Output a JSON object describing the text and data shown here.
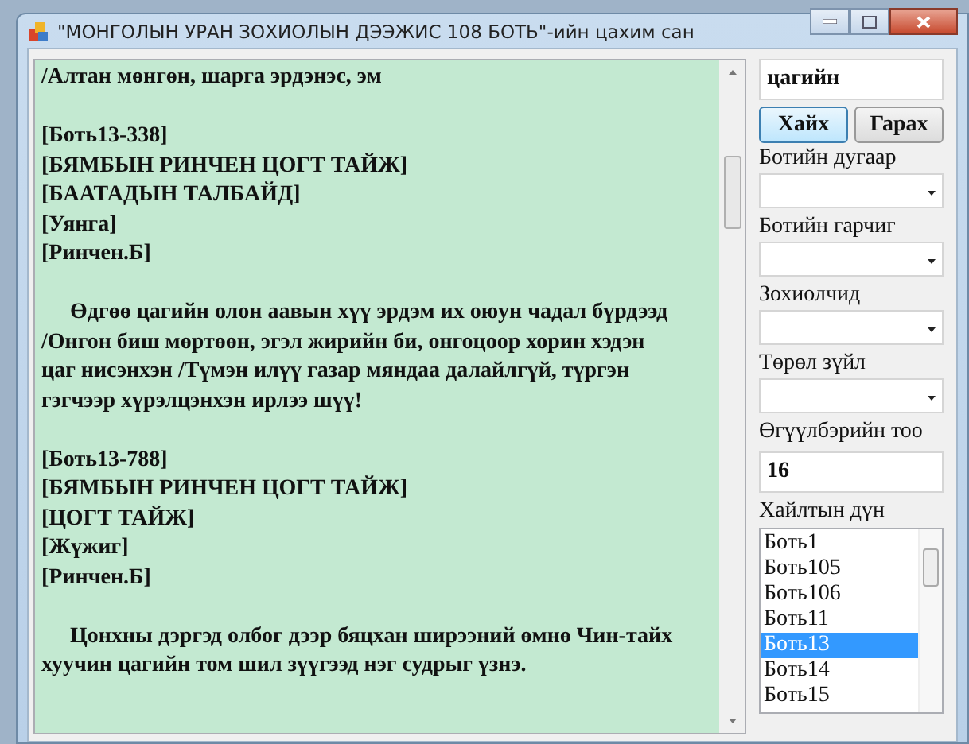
{
  "window": {
    "title": "\"МОНГОЛЫН УРАН ЗОХИОЛЫН ДЭЭЖИС 108 БОТЬ\"-ийн цахим сан"
  },
  "document": {
    "blocks": [
      {
        "kind": "lines",
        "lines": [
          "/Алтан мөнгөн, шарга эрдэнэс, эм"
        ]
      },
      {
        "kind": "lines",
        "lines": [
          "[Боть13-338]",
          "[БЯМБЫН РИНЧЕН ЦОГТ ТАЙЖ]",
          "[БААТАДЫН ТАЛБАЙД]",
          "[Уянга]",
          "[Ринчен.Б]"
        ]
      },
      {
        "kind": "paragraph",
        "lines": [
          "Өдгөө цагийн олон аавын хүү эрдэм их оюун чадал бүрдээд",
          "/Онгон биш мөртөөн, эгэл жирийн би, онгоцоор хорин хэдэн",
          "цаг нисэнхэн /Түмэн илүү газар мяндаа далайлгүй, түргэн",
          "гэгчээр хүрэлцэнхэн ирлээ шүү!"
        ]
      },
      {
        "kind": "lines",
        "lines": [
          "[Боть13-788]",
          "[БЯМБЫН РИНЧЕН ЦОГТ ТАЙЖ]",
          "[ЦОГТ ТАЙЖ]",
          "[Жүжиг]",
          "[Ринчен.Б]"
        ]
      },
      {
        "kind": "paragraph",
        "lines": [
          "Цонхны дэргэд олбог дээр бяцхан ширээний өмнө Чин-тайх",
          "хуучин цагийн том шил зүүгээд нэг судрыг үзнэ."
        ]
      }
    ]
  },
  "search": {
    "value": "цагийн"
  },
  "buttons": [
    {
      "label": "Хайх",
      "selected": true
    },
    {
      "label": "Гарах",
      "selected": false
    }
  ],
  "filters": [
    {
      "kind": "dropdown",
      "label": "Ботийн дугаар"
    },
    {
      "kind": "dropdown",
      "label": "Ботийн гарчиг"
    },
    {
      "kind": "dropdown",
      "label": "Зохиолчид"
    },
    {
      "kind": "dropdown",
      "label": "Төрөл зүйл"
    },
    {
      "kind": "field",
      "label": "Өгүүлбэрийн тоо",
      "value": "16"
    }
  ],
  "results": {
    "label": "Хайлтын дүн",
    "items": [
      {
        "label": "Боть1",
        "selected": false
      },
      {
        "label": "Боть105",
        "selected": false
      },
      {
        "label": "Боть106",
        "selected": false
      },
      {
        "label": "Боть11",
        "selected": false
      },
      {
        "label": "Боть13",
        "selected": true
      },
      {
        "label": "Боть14",
        "selected": false
      },
      {
        "label": "Боть15",
        "selected": false
      }
    ]
  }
}
